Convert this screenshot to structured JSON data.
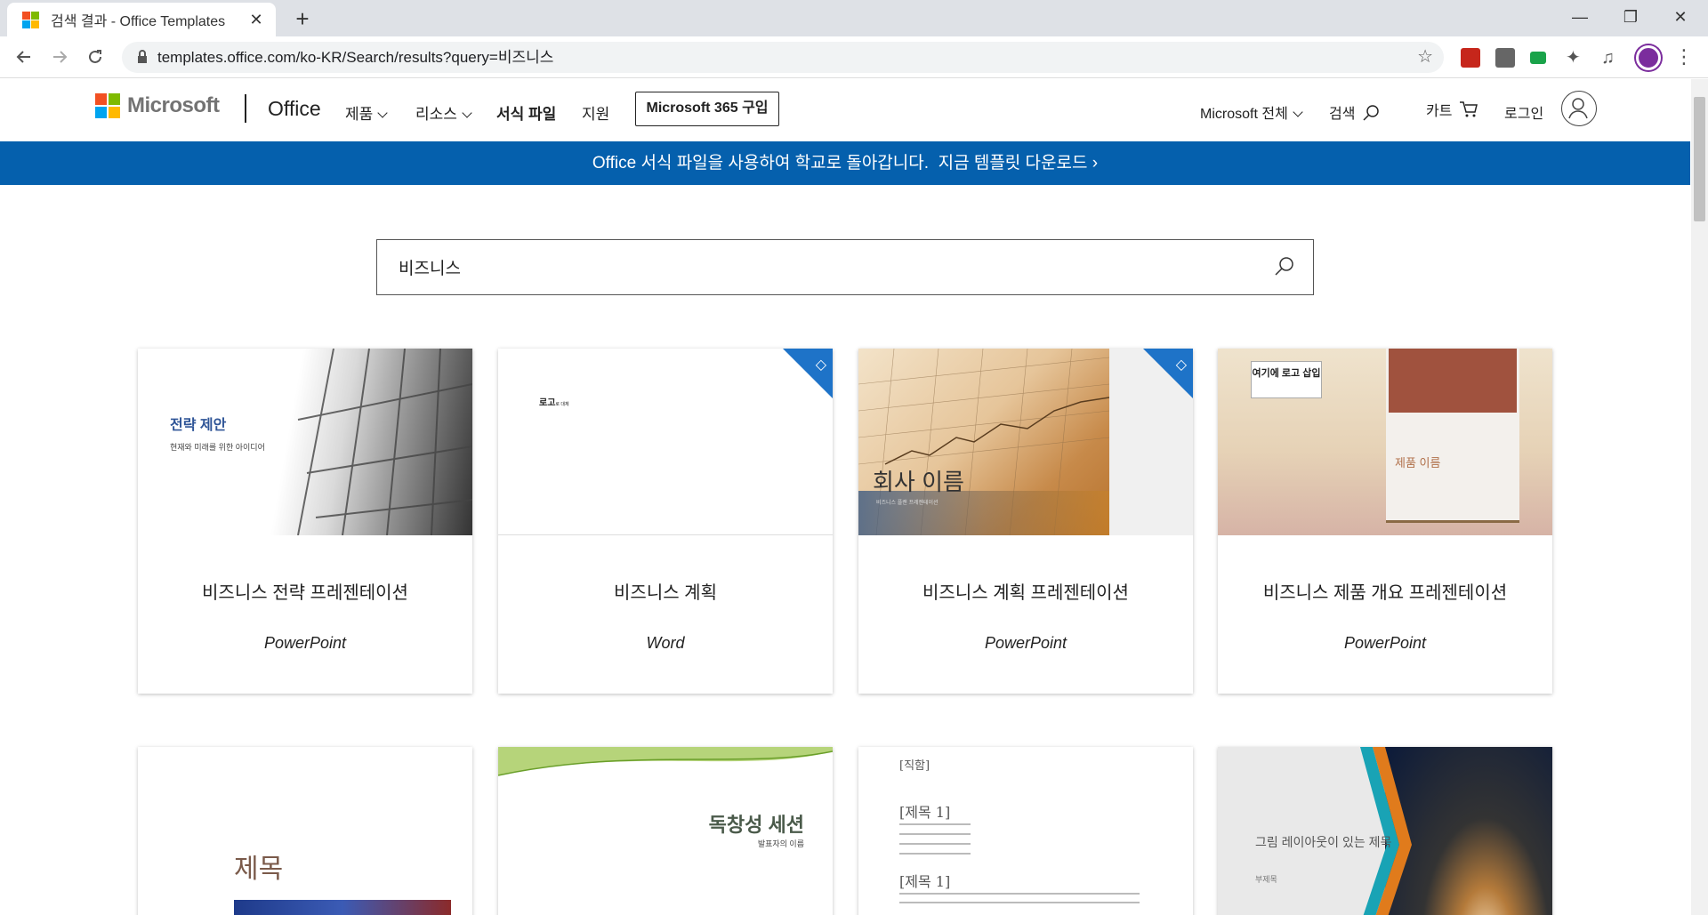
{
  "browser": {
    "tab_title": "검색 결과 - Office Templates",
    "tab_close": "✕",
    "new_tab": "+",
    "url": "templates.office.com/ko-KR/Search/results?query=비즈니스",
    "win_minimize": "—",
    "win_restore": "❐",
    "win_close": "✕"
  },
  "header": {
    "brand": "Microsoft",
    "product": "Office",
    "nav": [
      {
        "label": "제품"
      },
      {
        "label": "리소스"
      },
      {
        "label": "서식 파일"
      },
      {
        "label": "지원"
      }
    ],
    "buy_label": "Microsoft 365 구입",
    "all_microsoft": "Microsoft 전체",
    "search_label": "검색",
    "cart_label": "카트",
    "signin_label": "로그인"
  },
  "banner": {
    "text": "Office 서식 파일을 사용하여 학교로 돌아갑니다.",
    "link": "지금 템플릿 다운로드 ›"
  },
  "search": {
    "value": "비즈니스"
  },
  "results": [
    {
      "title": "비즈니스 전략 프레젠테이션",
      "app": "PowerPoint",
      "premium": false,
      "thumb": {
        "heading": "전략 제안",
        "sub": "현재와 미래를 위한 아이디어"
      }
    },
    {
      "title": "비즈니스 계획",
      "app": "Word",
      "premium": true,
      "thumb": {
        "heading": "로고",
        "sub": "로 대체"
      }
    },
    {
      "title": "비즈니스 계획 프레젠테이션",
      "app": "PowerPoint",
      "premium": true,
      "thumb": {
        "heading": "회사 이름",
        "sub": "비즈니스 플랜 프레젠테이션"
      }
    },
    {
      "title": "비즈니스 제품 개요 프레젠테이션",
      "app": "PowerPoint",
      "premium": false,
      "thumb": {
        "heading": "제품 이름",
        "sub": "여기에 로고 삽입"
      }
    }
  ],
  "results_row2": [
    {
      "thumb": {
        "heading": "제목"
      }
    },
    {
      "thumb": {
        "heading": "독창성 세션",
        "sub": "발표자의 이름"
      }
    },
    {
      "thumb": {
        "heading": "[직함]",
        "sub": "[제목 1]",
        "sub2": "[제목 1]"
      }
    },
    {
      "thumb": {
        "heading": "그림 레이아웃이 있는 제목",
        "sub": "부제목"
      }
    }
  ],
  "colors": {
    "banner_bg": "#0560ad",
    "premium_badge": "#1e73c8",
    "ms_red": "#f25022",
    "ms_green": "#7fba00",
    "ms_blue": "#00a4ef",
    "ms_yellow": "#ffb900"
  }
}
